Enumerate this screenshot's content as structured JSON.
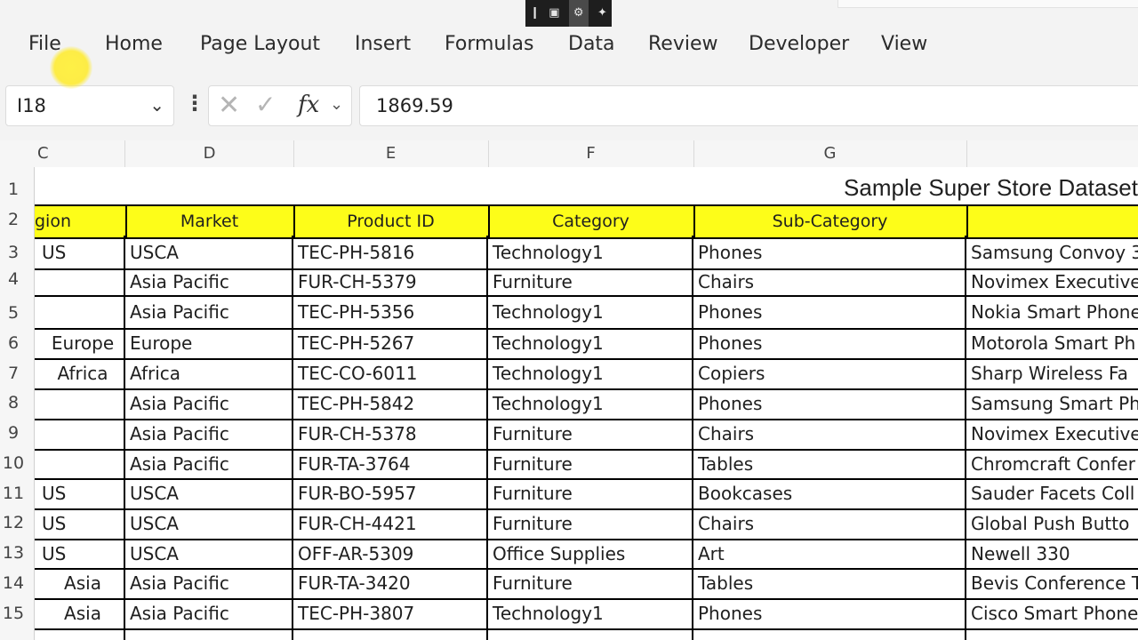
{
  "ribbon": {
    "tabs": [
      "File",
      "Home",
      "Page Layout",
      "Insert",
      "Formulas",
      "Data",
      "Review",
      "Developer",
      "View"
    ]
  },
  "mini_toolbar": {
    "icons": [
      "divider-icon",
      "screen-capture-icon",
      "settings-gear-icon",
      "pin-icon"
    ]
  },
  "formula_bar": {
    "name_box": "I18",
    "formula_value": "1869.59",
    "fx_label": "fx"
  },
  "grid": {
    "column_headers": [
      "C",
      "D",
      "E",
      "F",
      "G"
    ],
    "row_headers": [
      "1",
      "2",
      "3",
      "4",
      "5",
      "6",
      "7",
      "8",
      "9",
      "10",
      "11",
      "12",
      "13",
      "14",
      "15"
    ],
    "title": "Sample Super Store Dataset",
    "header_cells": [
      "gion",
      "Market",
      "Product ID",
      "Category",
      "Sub-Category",
      ""
    ],
    "rows": [
      [
        "US",
        "USCA",
        "TEC-PH-5816",
        "Technology1",
        "Phones",
        "Samsung Convoy 3"
      ],
      [
        "",
        "Asia Pacific",
        "FUR-CH-5379",
        "Furniture",
        "Chairs",
        "Novimex Executive"
      ],
      [
        "",
        "Asia Pacific",
        "TEC-PH-5356",
        "Technology1",
        "Phones",
        "Nokia Smart Phone"
      ],
      [
        "Europe",
        "Europe",
        "TEC-PH-5267",
        "Technology1",
        "Phones",
        "Motorola Smart Ph"
      ],
      [
        "Africa",
        "Africa",
        "TEC-CO-6011",
        "Technology1",
        "Copiers",
        "Sharp Wireless Fa"
      ],
      [
        "",
        "Asia Pacific",
        "TEC-PH-5842",
        "Technology1",
        "Phones",
        "Samsung Smart Ph"
      ],
      [
        "",
        "Asia Pacific",
        "FUR-CH-5378",
        "Furniture",
        "Chairs",
        "Novimex Executive"
      ],
      [
        "",
        "Asia Pacific",
        "FUR-TA-3764",
        "Furniture",
        "Tables",
        "Chromcraft Confer"
      ],
      [
        "US",
        "USCA",
        "FUR-BO-5957",
        "Furniture",
        "Bookcases",
        "Sauder Facets Coll"
      ],
      [
        "US",
        "USCA",
        "FUR-CH-4421",
        "Furniture",
        "Chairs",
        "Global Push Butto"
      ],
      [
        "US",
        "USCA",
        "OFF-AR-5309",
        "Office Supplies",
        "Art",
        "Newell 330"
      ],
      [
        "Asia",
        "Asia Pacific",
        "FUR-TA-3420",
        "Furniture",
        "Tables",
        "Bevis Conference T"
      ],
      [
        "Asia",
        "Asia Pacific",
        "TEC-PH-3807",
        "Technology1",
        "Phones",
        "Cisco Smart Phone"
      ]
    ]
  },
  "colors": {
    "header_fill": "#fdfd19",
    "ribbon_bg": "#f3f3f3",
    "cursor_highlight": "#ffeb28"
  }
}
